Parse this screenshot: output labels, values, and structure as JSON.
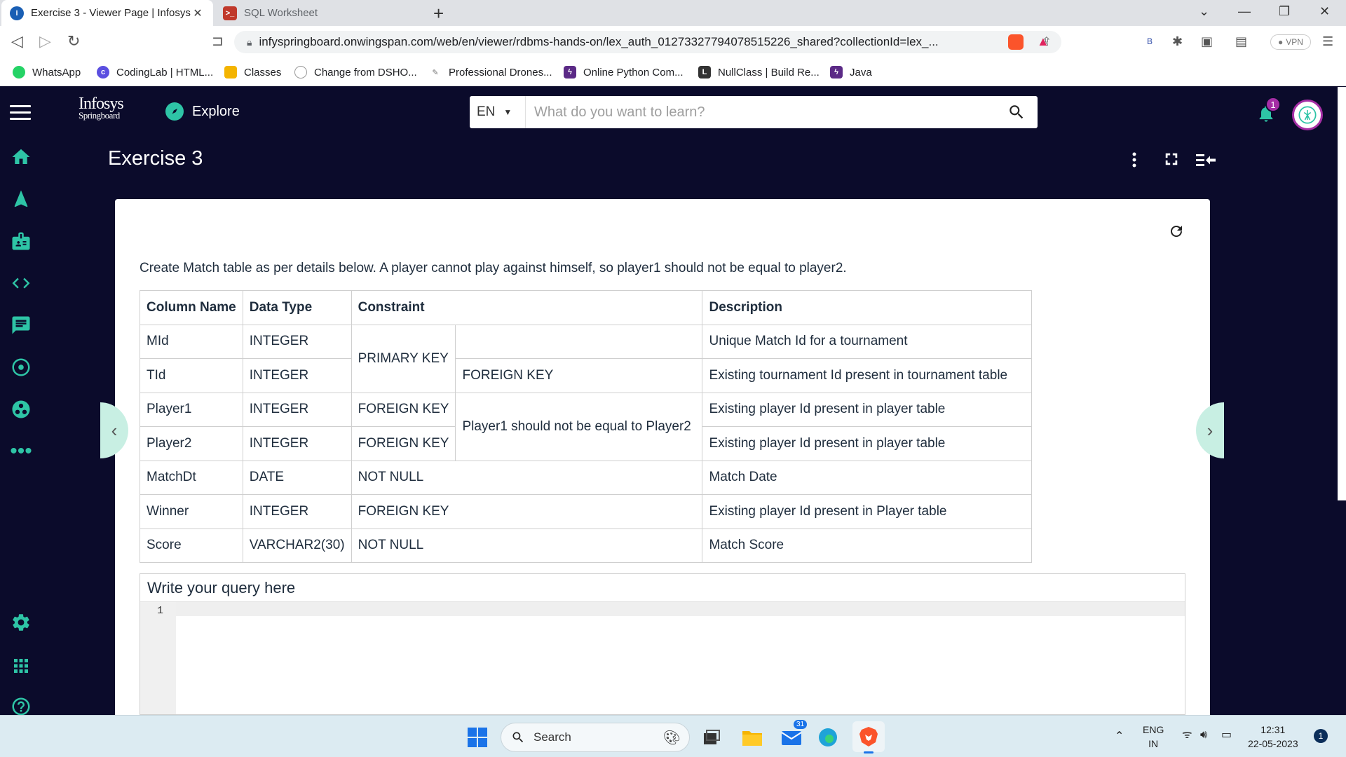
{
  "browser": {
    "tabs": [
      {
        "title": "Exercise 3 - Viewer Page | Infosys",
        "active": true
      },
      {
        "title": "SQL Worksheet",
        "active": false
      }
    ],
    "url": "infyspringboard.onwingspan.com/web/en/viewer/rdbms-hands-on/lex_auth_01273327794078515226_shared?collectionId=lex_...",
    "extension_label": "B",
    "vpn_label": "VPN",
    "bookmarks": [
      {
        "label": "WhatsApp",
        "color": "#25d366",
        "glyph": "W"
      },
      {
        "label": "CodingLab | HTML...",
        "color": "#5b4fe0",
        "glyph": "c"
      },
      {
        "label": "Classes",
        "color": "#f4b400",
        "glyph": "C"
      },
      {
        "label": "Change from DSHO...",
        "color": "#ffffff",
        "glyph": ""
      },
      {
        "label": "Professional Drones...",
        "color": "#ffffff",
        "glyph": ""
      },
      {
        "label": "Online Python Com...",
        "color": "#5b2a86",
        "glyph": "⚡"
      },
      {
        "label": "NullClass | Build Re...",
        "color": "#333333",
        "glyph": "L"
      },
      {
        "label": "Java",
        "color": "#5b2a86",
        "glyph": "⚡"
      }
    ]
  },
  "header": {
    "logo_line1": "Infosys",
    "logo_line2": "Springboard",
    "explore_label": "Explore",
    "language": "EN",
    "search_placeholder": "What do you want to learn?",
    "notification_count": "1"
  },
  "page": {
    "title": "Exercise 3",
    "description": "Create Match table as per details below. A player cannot play against himself, so player1 should not be equal to player2.",
    "table": {
      "headers": [
        "Column Name",
        "Data Type",
        "Constraint",
        "Description"
      ],
      "rows": [
        {
          "name": "MId",
          "type": "INTEGER",
          "desc": "Unique Match Id for a tournament"
        },
        {
          "name": "TId",
          "type": "INTEGER",
          "desc": "Existing tournament Id present in tournament table"
        },
        {
          "name": "Player1",
          "type": "INTEGER",
          "desc": "Existing player Id present in player table"
        },
        {
          "name": "Player2",
          "type": "INTEGER",
          "desc": "Existing player Id present in player table"
        },
        {
          "name": "MatchDt",
          "type": "DATE",
          "desc": "Match Date"
        },
        {
          "name": "Winner",
          "type": "INTEGER",
          "desc": "Existing player Id present in Player table"
        },
        {
          "name": "Score",
          "type": "VARCHAR2(30)",
          "desc": "Match Score"
        }
      ],
      "constraints": {
        "pk": "PRIMARY KEY",
        "tid_fk": "FOREIGN KEY",
        "player1_fk": "FOREIGN KEY",
        "player2_fk": "FOREIGN KEY",
        "check": "Player1 should not be equal to Player2",
        "matchdt": "NOT NULL",
        "winner": "FOREIGN KEY",
        "score": "NOT NULL"
      }
    },
    "editor": {
      "heading": "Write your query here",
      "line_number": "1"
    }
  },
  "taskbar": {
    "search_label": "Search",
    "mail_badge": "31",
    "lang_line1": "ENG",
    "lang_line2": "IN",
    "time": "12:31",
    "date": "22-05-2023",
    "notif_count": "1"
  },
  "colors": {
    "accent": "#2ec4a6",
    "background": "#0b0b2b",
    "badge": "#a52ea5"
  }
}
